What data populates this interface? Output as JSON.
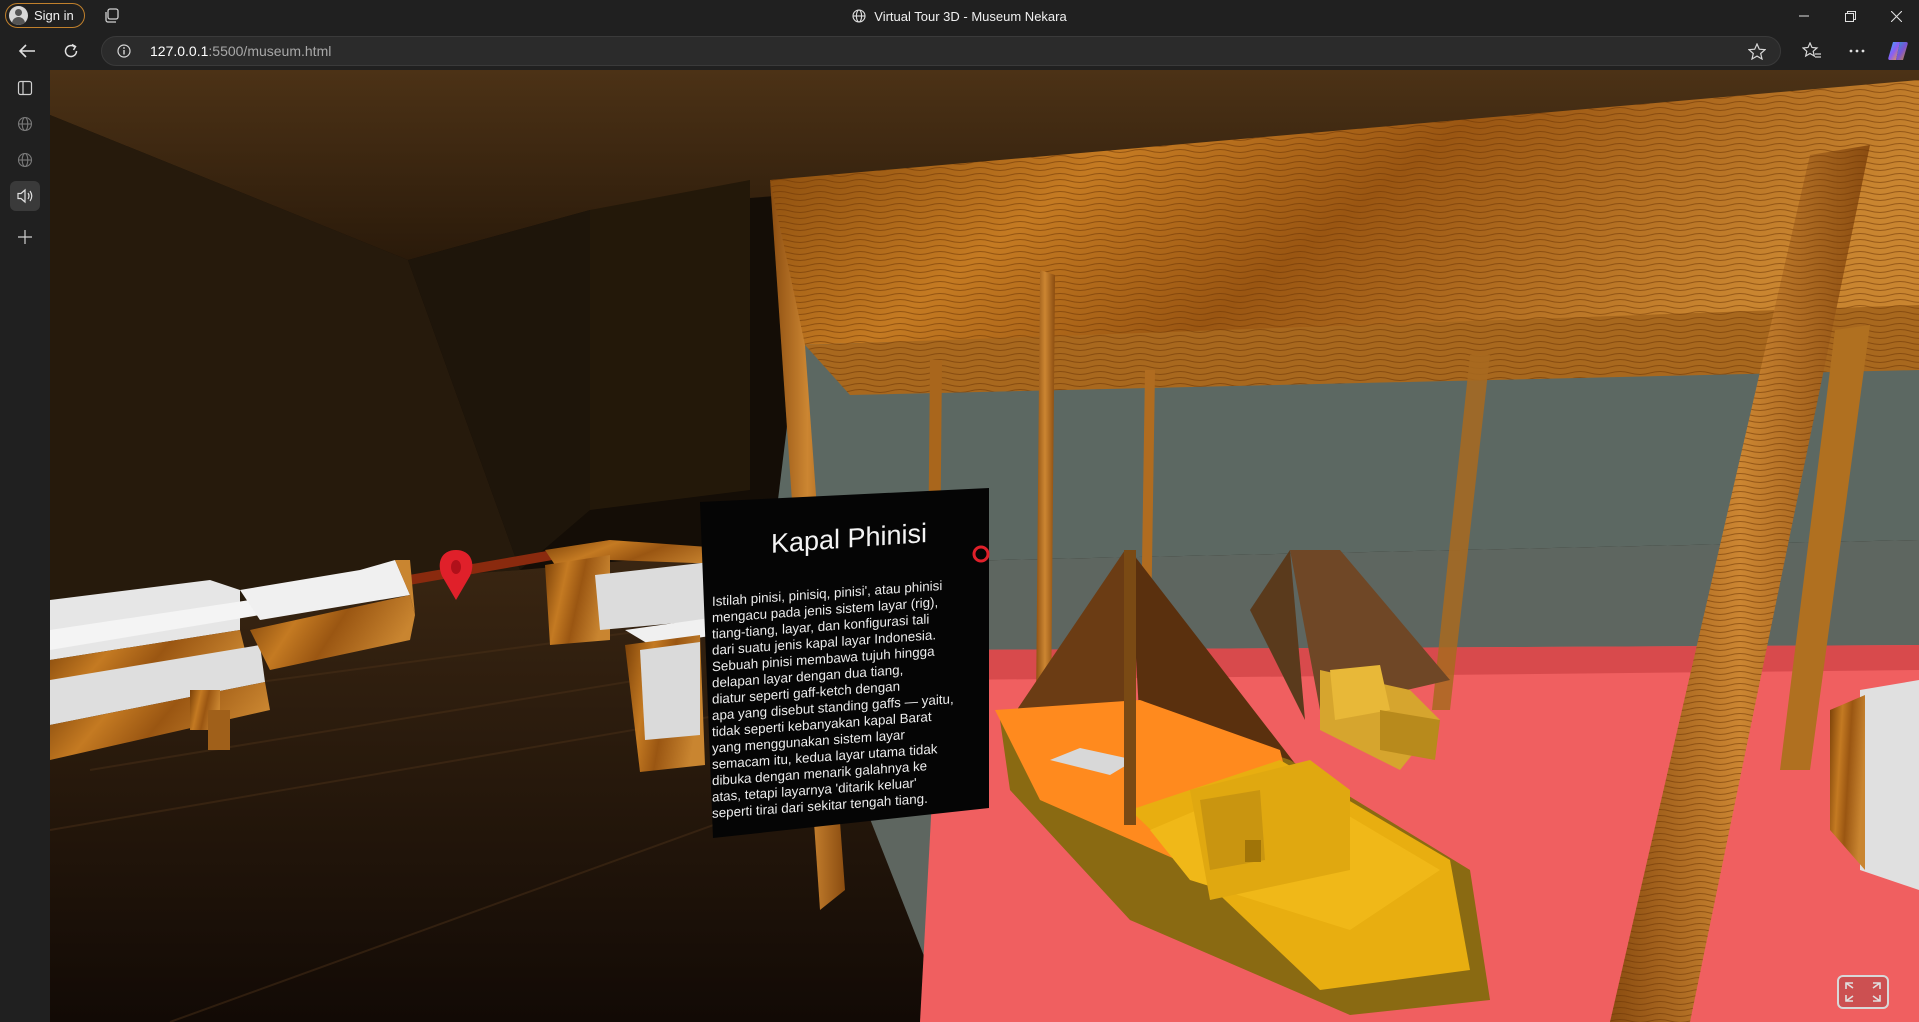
{
  "browser": {
    "sign_in_label": "Sign in",
    "window_title": "Virtual Tour 3D - Museum Nekara",
    "url_host": "127.0.0.1",
    "url_rest": ":5500/museum.html"
  },
  "sidebar": {
    "icons": [
      "panel-icon",
      "globe-icon",
      "globe-icon",
      "speaker-icon",
      "plus-icon"
    ]
  },
  "exhibit": {
    "title": "Kapal Phinisi",
    "description_lines": [
      "Istilah pinisi, pinisiq, pinisi', atau phinisi",
      "mengacu pada jenis sistem layar (rig),",
      "tiang-tiang, layar, dan konfigurasi tali",
      "dari suatu jenis kapal layar Indonesia.",
      "Sebuah pinisi membawa tujuh hingga",
      "delapan layar dengan dua tiang,",
      "diatur seperti gaff-ketch dengan",
      "apa yang disebut standing gaffs — yaitu,",
      "tidak seperti kebanyakan kapal Barat",
      "yang menggunakan sistem layar",
      "semacam itu, kedua layar utama tidak",
      "dibuka dengan menarik galahnya ke",
      "atas, tetapi layarnya 'ditarik keluar'",
      "seperti tirai dari sekitar tengah tiang."
    ]
  },
  "colors": {
    "brand_accent": "#c0802c",
    "marker": "#e0202a",
    "wood": "#b86a18"
  }
}
